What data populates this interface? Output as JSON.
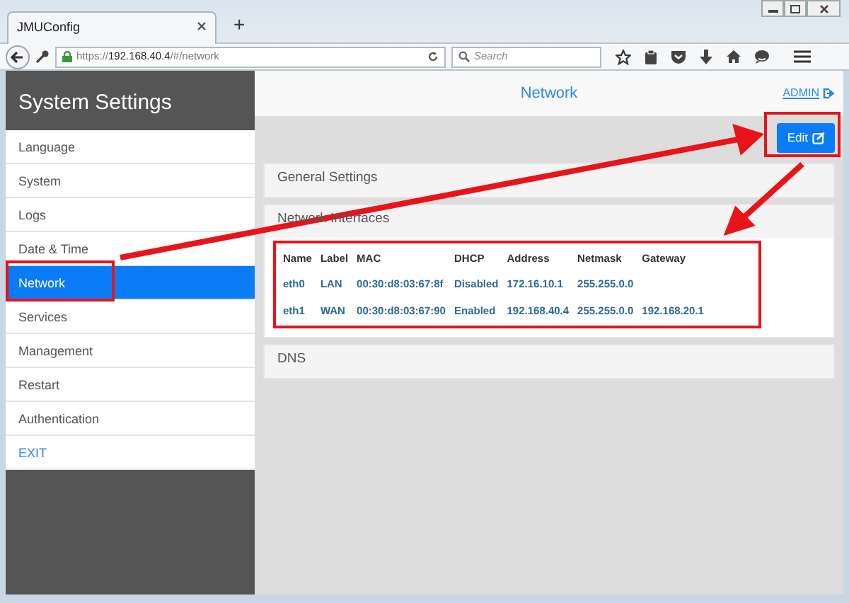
{
  "browser": {
    "tab_title": "JMUConfig",
    "new_tab": "+",
    "url": "https://**192.168.40.4**/#/network",
    "search_placeholder": "Search"
  },
  "sidebar": {
    "title": "System Settings",
    "items": [
      {
        "label": "Language",
        "kind": "page",
        "selected": false
      },
      {
        "label": "System",
        "kind": "page",
        "selected": false
      },
      {
        "label": "Logs",
        "kind": "page",
        "selected": false
      },
      {
        "label": "Date & Time",
        "kind": "page",
        "selected": false
      },
      {
        "label": "Network",
        "kind": "page",
        "selected": true
      },
      {
        "label": "Services",
        "kind": "page",
        "selected": false
      },
      {
        "label": "Management",
        "kind": "page",
        "selected": false
      },
      {
        "label": "Restart",
        "kind": "page",
        "selected": false
      },
      {
        "label": "Authentication",
        "kind": "page",
        "selected": false
      },
      {
        "label": "EXIT",
        "kind": "action",
        "selected": false
      }
    ]
  },
  "header": {
    "title": "Network",
    "user": "ADMIN"
  },
  "edit_button": "Edit",
  "panels": [
    {
      "title": "General Settings"
    },
    {
      "title": "Network Interfaces",
      "table": {
        "columns": [
          "Name",
          "Label",
          "MAC",
          "DHCP",
          "Address",
          "Netmask",
          "Gateway"
        ],
        "rows": [
          [
            "eth0",
            "LAN",
            "00:30:d8:03:67:8f",
            "Disabled",
            "172.16.10.1",
            "255.255.0.0",
            ""
          ],
          [
            "eth1",
            "WAN",
            "00:30:d8:03:67:90",
            "Enabled",
            "192.168.40.4",
            "255.255.0.0",
            "192.168.20.1"
          ]
        ]
      }
    },
    {
      "title": "DNS"
    }
  ]
}
